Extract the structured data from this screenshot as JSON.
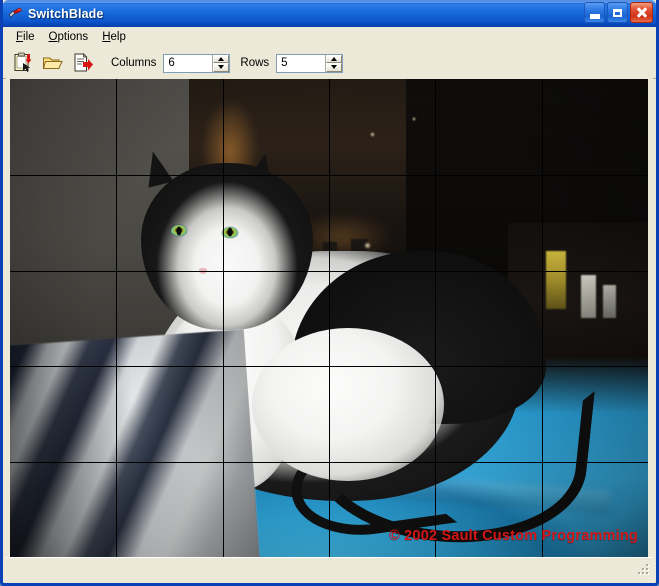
{
  "window": {
    "title": "SwitchBlade",
    "icon": "switchblade-knife-icon",
    "controls": {
      "minimize_label": "Minimize",
      "maximize_label": "Maximize",
      "close_label": "Close"
    }
  },
  "menubar": {
    "items": [
      {
        "label": "File",
        "accel": "F"
      },
      {
        "label": "Options",
        "accel": "O"
      },
      {
        "label": "Help",
        "accel": "H"
      }
    ]
  },
  "toolbar": {
    "buttons": [
      {
        "name": "capture-screen-icon",
        "tooltip": "New / Capture"
      },
      {
        "name": "open-folder-icon",
        "tooltip": "Open"
      },
      {
        "name": "export-file-icon",
        "tooltip": "Export"
      }
    ],
    "columns": {
      "label": "Columns",
      "value": "6",
      "placeholder": "6"
    },
    "rows": {
      "label": "Rows",
      "value": "5",
      "placeholder": "5"
    }
  },
  "canvas": {
    "image_alt": "Black and white tuxedo cat lying on a blue blanket in a dim room",
    "grid": {
      "columns": 6,
      "rows": 5,
      "line_color": "#000000",
      "vertical_positions_pct": [
        16.67,
        33.33,
        50.0,
        66.67,
        83.33
      ],
      "horizontal_positions_pct": [
        20.0,
        40.0,
        60.0,
        80.0
      ]
    },
    "copyright": "© 2002 Sault Custom Programming",
    "copyright_color": "#d41616"
  },
  "statusbar": {
    "text": "",
    "resize_grip": "resize-grip-icon"
  },
  "colors": {
    "titlebar_blue": "#0a5fd6",
    "window_border": "#0a41b5",
    "face_bg": "#ece9d8",
    "close_red": "#cf3318",
    "field_border": "#7f9db9"
  }
}
